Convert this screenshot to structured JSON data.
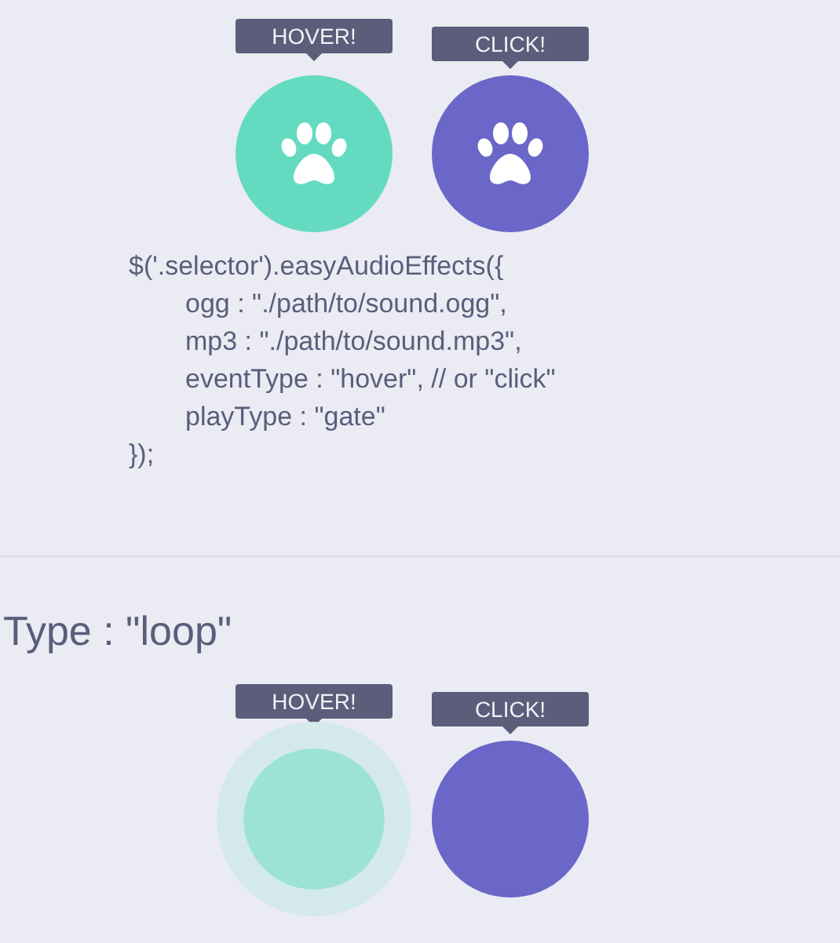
{
  "sections": [
    {
      "buttons": [
        {
          "tooltip": "HOVER!",
          "color": "#64dbc1",
          "playing": false,
          "kind": "paw"
        },
        {
          "tooltip": "CLICK!",
          "color": "#6a67c8",
          "playing": false,
          "kind": "paw"
        }
      ],
      "code": [
        {
          "text": "$('.selector').easyAudioEffects({",
          "children": [
            {
              "text": "ogg : \"./path/to/sound.ogg\","
            },
            {
              "text": "mp3 : \"./path/to/sound.mp3\","
            },
            {
              "text": "eventType : \"hover\", // or \"click\""
            },
            {
              "text": "playType : \"gate\""
            }
          ]
        },
        {
          "text": "});"
        }
      ]
    },
    {
      "heading": "Type : \"loop\"",
      "buttons": [
        {
          "tooltip": "HOVER!",
          "color": "#9ce3d6",
          "playing": true,
          "kind": "blank"
        },
        {
          "tooltip": "CLICK!",
          "color": "#6a67c8",
          "playing": false,
          "kind": "blank"
        }
      ]
    }
  ]
}
